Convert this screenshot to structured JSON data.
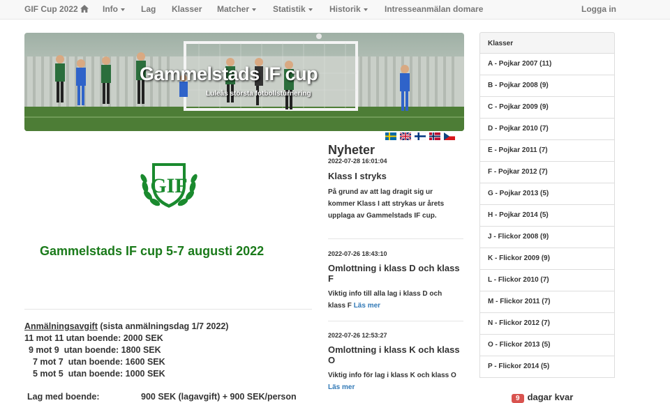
{
  "nav": {
    "brand": "GIF Cup 2022",
    "items": [
      {
        "label": "Info",
        "dropdown": true
      },
      {
        "label": "Lag",
        "dropdown": false
      },
      {
        "label": "Klasser",
        "dropdown": false
      },
      {
        "label": "Matcher",
        "dropdown": true
      },
      {
        "label": "Statistik",
        "dropdown": true
      },
      {
        "label": "Historik",
        "dropdown": true
      },
      {
        "label": "Intresseanmälan domare",
        "dropdown": false
      }
    ],
    "login": "Logga in"
  },
  "hero": {
    "title": "Gammelstads IF cup",
    "subtitle": "Luleås största fotbollsturnering"
  },
  "flags": [
    "swedish-flag",
    "british-flag",
    "finnish-flag",
    "norwegian-flag",
    "czech-flag"
  ],
  "main": {
    "cup_title": "Gammelstads IF cup 5-7 augusti 2022",
    "fee_heading": "Anmälningsavgift",
    "fee_note": " (sista anmälningsdag 1/7 2022)",
    "fees": [
      {
        "format": "11 mot 11",
        "text": "utan boende:",
        "price": "2000 SEK"
      },
      {
        "format": "9 mot 9",
        "text": "utan boende:",
        "price": "1800 SEK"
      },
      {
        "format": "7 mot 7",
        "text": "utan boende:",
        "price": "1600 SEK"
      },
      {
        "format": "5 mot 5",
        "text": "utan boende:",
        "price": "1000 SEK"
      }
    ],
    "lodging_label": "Lag med boende:",
    "lodging_price": "900 SEK (lagavgift) + 900 SEK/person"
  },
  "news": {
    "title": "Nyheter",
    "items": [
      {
        "date": "2022-07-28 16:01:04",
        "heading": "Klass I stryks",
        "body": "På grund av att lag dragit sig ur kommer Klass I att strykas ur årets upplaga av Gammelstads IF cup.",
        "more": ""
      },
      {
        "date": "2022-07-26 18:43:10",
        "heading": "Omlottning i klass D och klass F",
        "body": "Viktig info till alla lag i klass D och klass F ",
        "more": "Läs mer"
      },
      {
        "date": "2022-07-26 12:53:27",
        "heading": "Omlottning i klass K och klass O",
        "body": "Viktig info för lag i klass K och klass O ",
        "more": "Läs mer"
      }
    ]
  },
  "sidebar": {
    "heading": "Klasser",
    "items": [
      "A - Pojkar 2007 (11)",
      "B - Pojkar 2008 (9)",
      "C - Pojkar 2009 (9)",
      "D - Pojkar 2010 (7)",
      "E - Pojkar 2011 (7)",
      "F - Pojkar 2012 (7)",
      "G - Pojkar 2013 (5)",
      "H - Pojkar 2014 (5)",
      "J - Flickor 2008 (9)",
      "K - Flickor 2009 (9)",
      "L - Flickor 2010 (7)",
      "M - Flickor 2011 (7)",
      "N - Flickor 2012 (7)",
      "O - Flickor 2013 (5)",
      "P - Flickor 2014 (5)"
    ]
  },
  "countdown": {
    "days": "9",
    "label": "dagar kvar"
  },
  "colors": {
    "accent": "#337ab7",
    "cup_green": "#1a7a1a",
    "badge": "#d9534f"
  }
}
